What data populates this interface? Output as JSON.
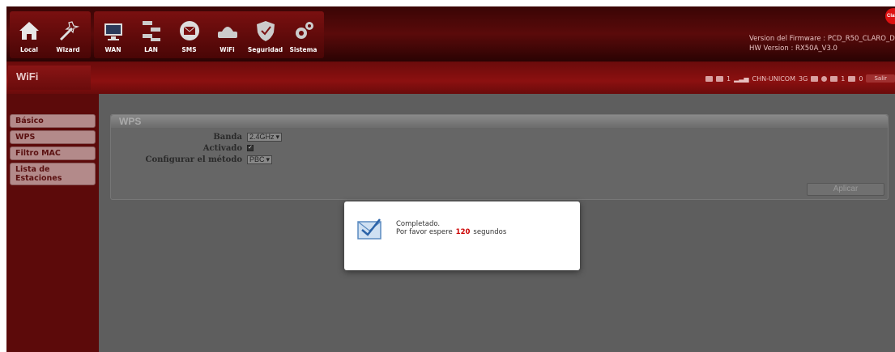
{
  "nav": {
    "group1": [
      {
        "label": "Local",
        "icon": "home-icon"
      },
      {
        "label": "Wizard",
        "icon": "wand-icon"
      }
    ],
    "group2": [
      {
        "label": "WAN",
        "icon": "globe-icon"
      },
      {
        "label": "LAN",
        "icon": "network-icon"
      },
      {
        "label": "SMS",
        "icon": "envelope-icon"
      },
      {
        "label": "WiFi",
        "icon": "router-icon"
      },
      {
        "label": "Seguridad",
        "icon": "shield-icon"
      },
      {
        "label": "Sistema",
        "icon": "gears-icon"
      }
    ]
  },
  "firmware": {
    "line1": "Version del Firmware : PCD_R50_CLARO_DR_",
    "line2": "HW Version : RX50A_V3.0"
  },
  "brand_text": "Clar",
  "page_title": "WiFi",
  "status": {
    "count1": "1",
    "operator": "CHN-UNICOM",
    "network": "3G",
    "count2": "1",
    "count3": "0",
    "logout": "Salir"
  },
  "sidebar": {
    "items": [
      "Básico",
      "WPS",
      "Filtro MAC",
      "Lista de Estaciones"
    ]
  },
  "panel": {
    "title": "WPS",
    "banda_label": "Banda",
    "banda_value": "2.4GHz",
    "activado_label": "Activado",
    "activado_checked": true,
    "metodo_label": "Configurar el método",
    "metodo_value": "PBC",
    "apply": "Aplicar"
  },
  "modal": {
    "line1": "Completado.",
    "line2_prefix": "Por favor espere",
    "countdown": "120",
    "line2_suffix": "segundos"
  },
  "colors": {
    "topbar": "#4a0808",
    "subbar": "#8c1010",
    "sidebar": "#5c0a0a",
    "main": "#5e5e5e",
    "countdown": "#cc0000"
  }
}
